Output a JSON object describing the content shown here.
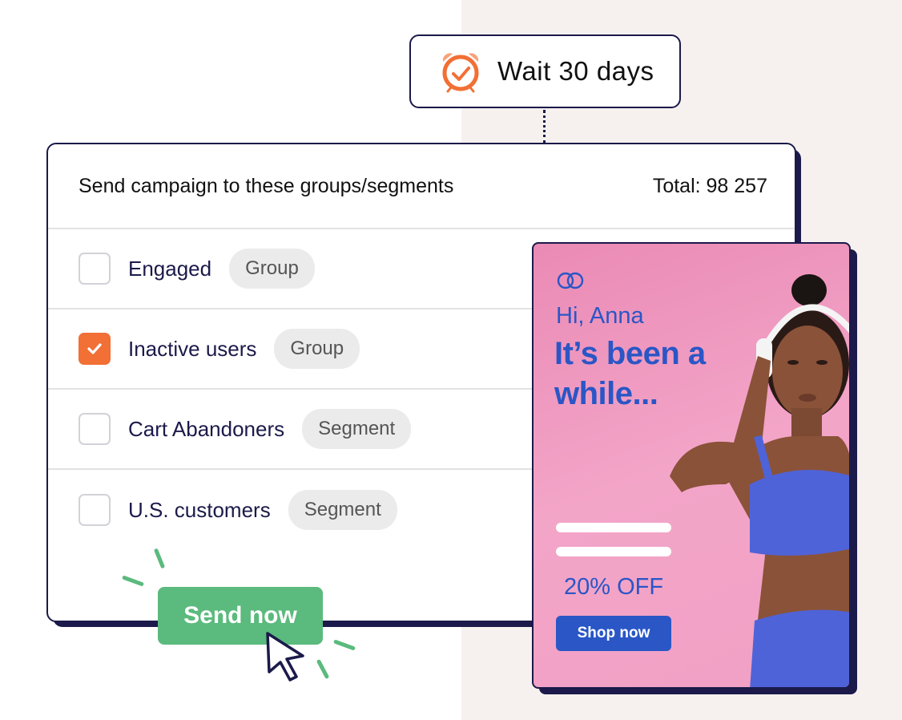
{
  "wait_node": {
    "label": "Wait 30 days",
    "icon": "alarm-clock-icon",
    "icon_color": "#f26f35"
  },
  "campaign": {
    "title": "Send campaign to these groups/segments",
    "total": "Total: 98 257",
    "rows": [
      {
        "label": "Engaged",
        "tag": "Group",
        "checked": false
      },
      {
        "label": "Inactive users",
        "tag": "Group",
        "checked": true
      },
      {
        "label": "Cart Abandoners",
        "tag": "Segment",
        "checked": false
      },
      {
        "label": "U.S. customers",
        "tag": "Segment",
        "checked": false
      }
    ]
  },
  "send_button": {
    "label": "Send now",
    "color": "#5bba7d"
  },
  "email_preview": {
    "logo_icon": "interlocking-rings-logo",
    "greeting": "Hi, Anna",
    "headline": "It’s been a while...",
    "discount": "20% OFF",
    "cta": "Shop now",
    "accent": "#2a56c6"
  },
  "colors": {
    "navy": "#1b1a4a",
    "orange": "#f26f35",
    "pink": "#f3a5c8"
  }
}
